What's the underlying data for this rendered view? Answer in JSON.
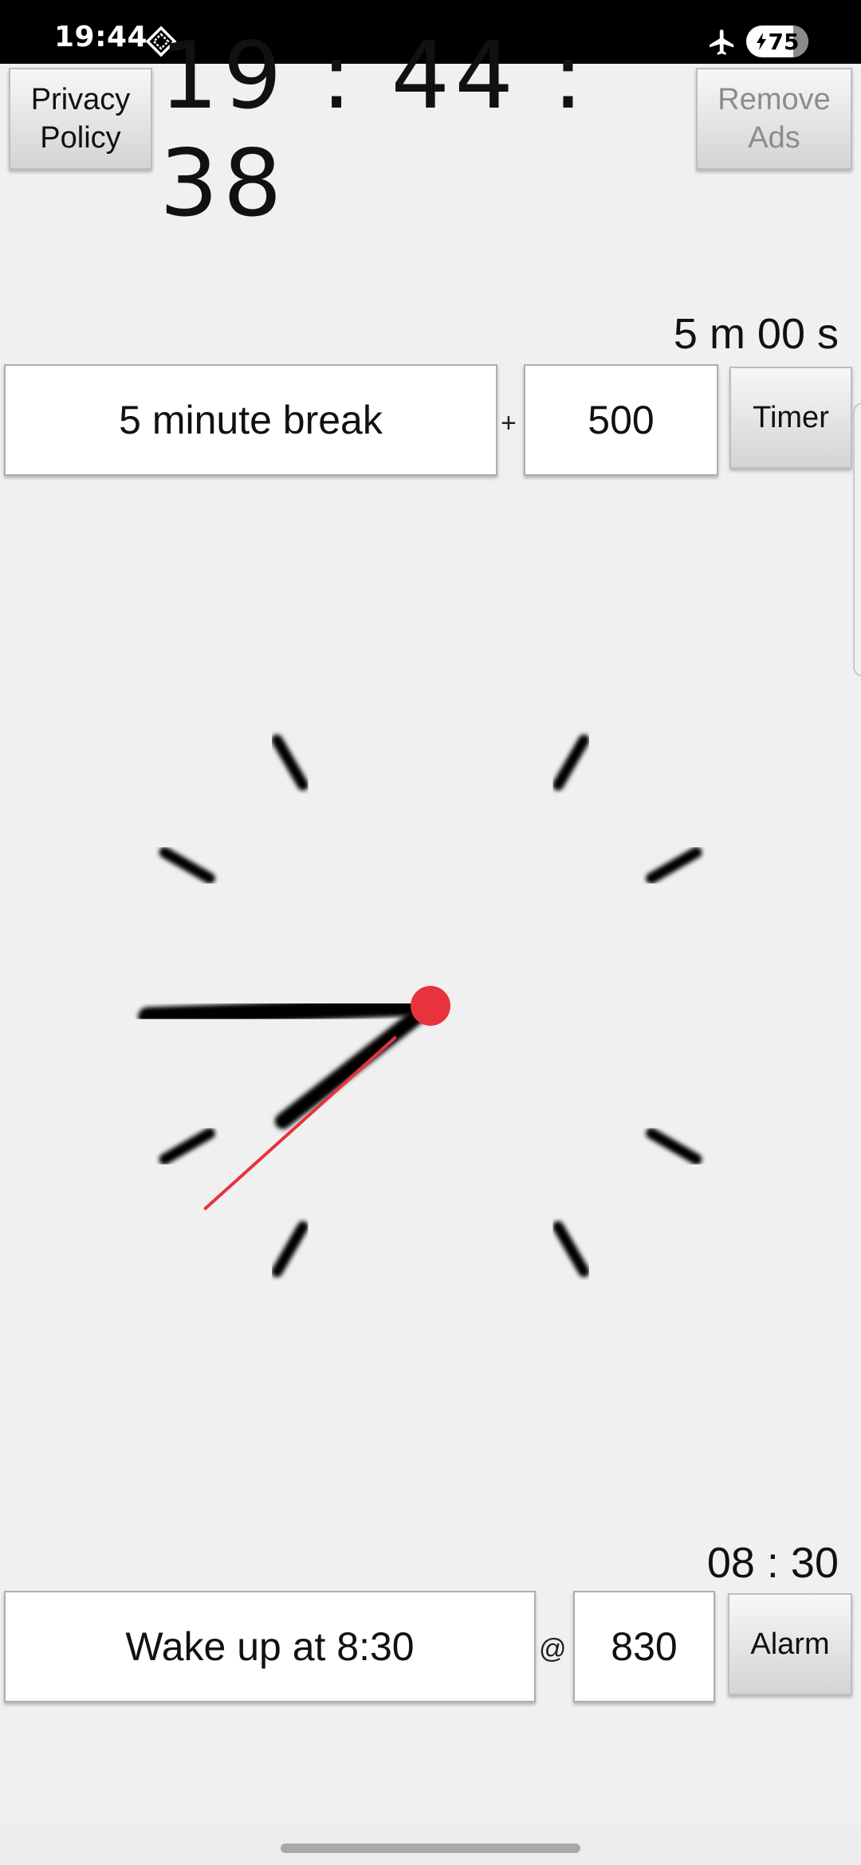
{
  "status_bar": {
    "time": "19:44",
    "battery_level": "75",
    "battery_fraction": 0.75,
    "icons": [
      "signal-diamond-icon",
      "airplane-mode-icon",
      "battery-charging-icon"
    ]
  },
  "header": {
    "privacy_button": {
      "line1": "Privacy",
      "line2": "Policy"
    },
    "digital_clock": "19 : 44 : 38",
    "remove_ads_button": {
      "line1": "Remove",
      "line2": "Ads"
    }
  },
  "timer": {
    "readout": "5 m 00 s",
    "label_value": "5 minute break",
    "separator": "+",
    "duration_value": "500",
    "button_label": "Timer"
  },
  "analog_clock": {
    "hours": 19,
    "minutes": 44,
    "seconds": 38,
    "colors": {
      "hands": "#000000",
      "second_hand": "#e8323c",
      "ticks": "#000000"
    }
  },
  "alarm": {
    "readout": "08 : 30",
    "label_value": "Wake up at 8:30",
    "separator": "@",
    "time_value": "830",
    "button_label": "Alarm"
  }
}
